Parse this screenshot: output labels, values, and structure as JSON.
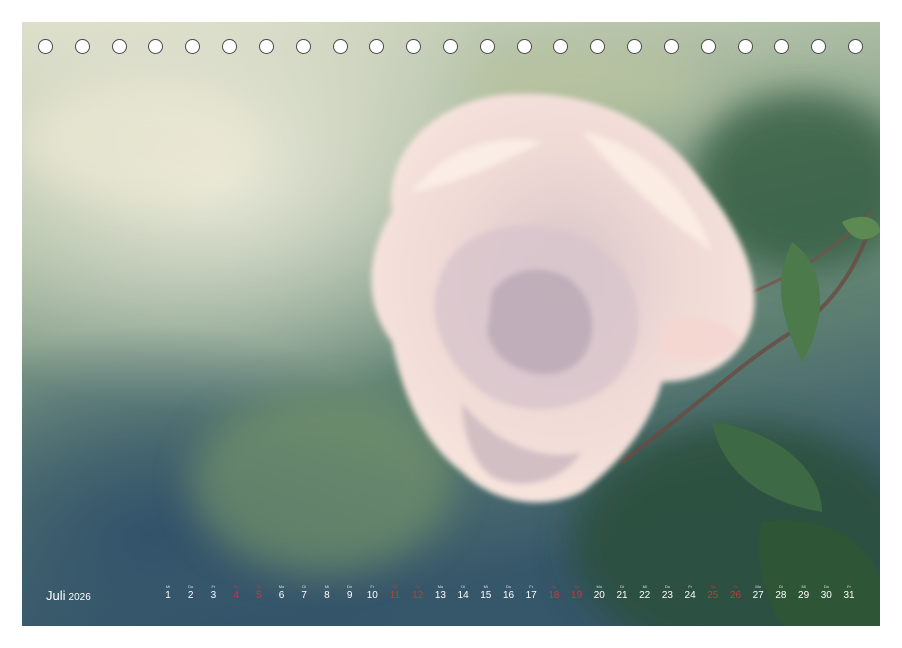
{
  "calendar": {
    "month": "Juli",
    "year": "2026",
    "holes": 23,
    "days": [
      {
        "wd": "Mi",
        "n": "1",
        "we": false
      },
      {
        "wd": "Do",
        "n": "2",
        "we": false
      },
      {
        "wd": "Fr",
        "n": "3",
        "we": false
      },
      {
        "wd": "Sa",
        "n": "4",
        "we": true
      },
      {
        "wd": "So",
        "n": "5",
        "we": true
      },
      {
        "wd": "Mo",
        "n": "6",
        "we": false
      },
      {
        "wd": "Di",
        "n": "7",
        "we": false
      },
      {
        "wd": "Mi",
        "n": "8",
        "we": false
      },
      {
        "wd": "Do",
        "n": "9",
        "we": false
      },
      {
        "wd": "Fr",
        "n": "10",
        "we": false
      },
      {
        "wd": "Sa",
        "n": "11",
        "we": true
      },
      {
        "wd": "So",
        "n": "12",
        "we": true
      },
      {
        "wd": "Mo",
        "n": "13",
        "we": false
      },
      {
        "wd": "Di",
        "n": "14",
        "we": false
      },
      {
        "wd": "Mi",
        "n": "15",
        "we": false
      },
      {
        "wd": "Do",
        "n": "16",
        "we": false
      },
      {
        "wd": "Fr",
        "n": "17",
        "we": false
      },
      {
        "wd": "Sa",
        "n": "18",
        "we": true
      },
      {
        "wd": "So",
        "n": "19",
        "we": true
      },
      {
        "wd": "Mo",
        "n": "20",
        "we": false
      },
      {
        "wd": "Di",
        "n": "21",
        "we": false
      },
      {
        "wd": "Mi",
        "n": "22",
        "we": false
      },
      {
        "wd": "Do",
        "n": "23",
        "we": false
      },
      {
        "wd": "Fr",
        "n": "24",
        "we": false
      },
      {
        "wd": "Sa",
        "n": "25",
        "we": true
      },
      {
        "wd": "So",
        "n": "26",
        "we": true
      },
      {
        "wd": "Mo",
        "n": "27",
        "we": false
      },
      {
        "wd": "Di",
        "n": "28",
        "we": false
      },
      {
        "wd": "Mi",
        "n": "29",
        "we": false
      },
      {
        "wd": "Do",
        "n": "30",
        "we": false
      },
      {
        "wd": "Fr",
        "n": "31",
        "we": false
      }
    ]
  },
  "colors": {
    "weekend": "#c43a3a",
    "petal": "#f3dcd6",
    "leaf": "#2f5a3e",
    "background": "#6f8a74"
  }
}
